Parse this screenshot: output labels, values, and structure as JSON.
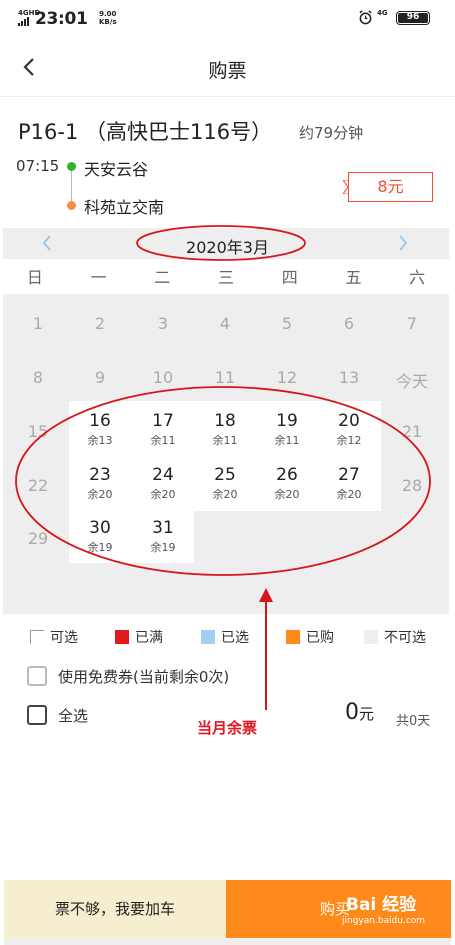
{
  "status_bar": {
    "network": "4GHD",
    "time": "23:01",
    "speed_value": "9.00",
    "speed_unit": "KB/s",
    "net_type": "4G",
    "battery": "96"
  },
  "nav": {
    "title": "购票"
  },
  "route": {
    "name": "P16-1 （高快巴士116号）",
    "duration": "约79分钟",
    "departure_time": "07:15",
    "start_station": "天安云谷",
    "end_station": "科苑立交南",
    "price": "8元"
  },
  "calendar": {
    "month": "2020年3月",
    "weekdays": [
      "日",
      "一",
      "二",
      "三",
      "四",
      "五",
      "六"
    ],
    "row1": [
      "1",
      "2",
      "3",
      "4",
      "5",
      "6",
      "7"
    ],
    "row2": [
      "8",
      "9",
      "10",
      "11",
      "12",
      "13",
      "今天"
    ],
    "row3_before": "15",
    "row3_after": "21",
    "row4_before": "22",
    "row4_after": "28",
    "row5_before": "29",
    "available": [
      {
        "day": "16",
        "remain": "余13"
      },
      {
        "day": "17",
        "remain": "余11"
      },
      {
        "day": "18",
        "remain": "余11"
      },
      {
        "day": "19",
        "remain": "余11"
      },
      {
        "day": "20",
        "remain": "余12"
      },
      {
        "day": "23",
        "remain": "余20"
      },
      {
        "day": "24",
        "remain": "余20"
      },
      {
        "day": "25",
        "remain": "余20"
      },
      {
        "day": "26",
        "remain": "余20"
      },
      {
        "day": "27",
        "remain": "余20"
      },
      {
        "day": "30",
        "remain": "余19"
      },
      {
        "day": "31",
        "remain": "余19"
      }
    ]
  },
  "legend": {
    "selectable": "可选",
    "full": "已满",
    "selected": "已选",
    "bought": "已购",
    "unavailable": "不可选",
    "colors": {
      "full": "#e01b1b",
      "selected": "#a5cff2",
      "bought": "#ff8a1c",
      "unavailable": "#eeeeee"
    }
  },
  "coupon_label": "使用免费券(当前剩余0次)",
  "select_all_label": "全选",
  "total": {
    "amount": "0",
    "unit": "元",
    "days": "共0天"
  },
  "annotation": "当月余票",
  "buttons": {
    "add_bus": "票不够，我要加车",
    "buy": "购买"
  },
  "watermark": {
    "brand": "Bai 经验",
    "url": "jingyan.baidu.com"
  }
}
